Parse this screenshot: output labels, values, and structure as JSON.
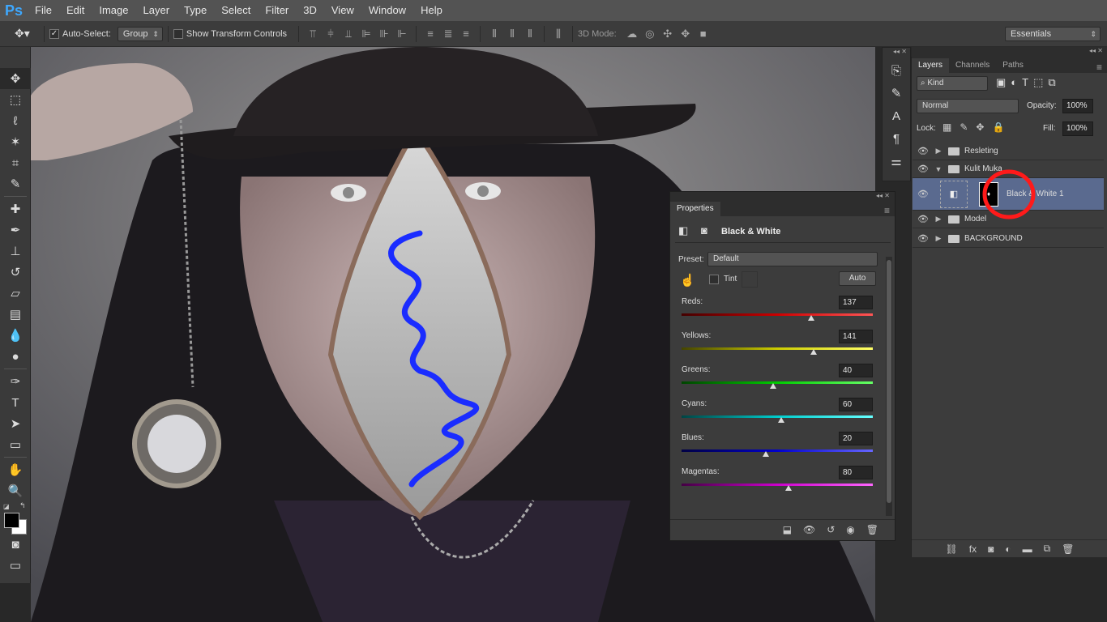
{
  "app": {
    "logo": "Ps"
  },
  "menu": [
    "File",
    "Edit",
    "Image",
    "Layer",
    "Type",
    "Select",
    "Filter",
    "3D",
    "View",
    "Window",
    "Help"
  ],
  "options": {
    "auto_select_label": "Auto-Select:",
    "auto_select_value": "Group",
    "show_transform_label": "Show Transform Controls",
    "mode_3d_label": "3D Mode:",
    "workspace": "Essentials"
  },
  "layers_panel": {
    "tabs": [
      "Layers",
      "Channels",
      "Paths"
    ],
    "kind_label": "Kind",
    "blend_mode": "Normal",
    "opacity_label": "Opacity:",
    "opacity_value": "100%",
    "lock_label": "Lock:",
    "fill_label": "Fill:",
    "fill_value": "100%",
    "layers": [
      {
        "name": "Resleting"
      },
      {
        "name": "Kulit Muka"
      },
      {
        "name": "Black & White 1"
      },
      {
        "name": "Model"
      },
      {
        "name": "BACKGROUND"
      }
    ]
  },
  "properties": {
    "title": "Properties",
    "adjustment_name": "Black & White",
    "preset_label": "Preset:",
    "preset_value": "Default",
    "tint_label": "Tint",
    "auto_label": "Auto",
    "sliders": [
      {
        "label": "Reds:",
        "value": "137",
        "fraction": 0.68
      },
      {
        "label": "Yellows:",
        "value": "141",
        "fraction": 0.69
      },
      {
        "label": "Greens:",
        "value": "40",
        "fraction": 0.48
      },
      {
        "label": "Cyans:",
        "value": "60",
        "fraction": 0.52
      },
      {
        "label": "Blues:",
        "value": "20",
        "fraction": 0.44
      },
      {
        "label": "Magentas:",
        "value": "80",
        "fraction": 0.56
      }
    ]
  },
  "colors": {
    "accent_blue": "#3ea8ff",
    "annotation_red": "#ff1a1a",
    "scribble_blue": "#1a2cff",
    "selected_layer": "#5a6a8f"
  }
}
